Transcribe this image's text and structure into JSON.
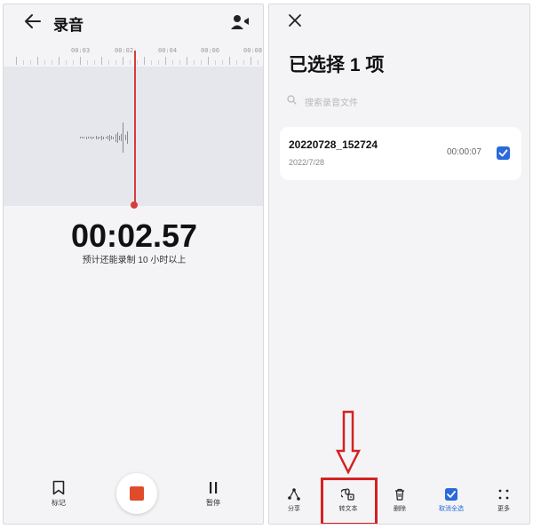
{
  "left_screen": {
    "title": "录音",
    "ruler_labels": [
      "00:03",
      "00:02",
      "00:04",
      "00:06",
      "00:08"
    ],
    "timer": "00:02.57",
    "remaining": "预计还能录制 10 小时以上",
    "toolbar": {
      "mark_label": "标记",
      "pause_label": "暂停"
    },
    "colors": {
      "record": "#e04b2b",
      "playhead": "#d93a3a"
    },
    "icons": [
      "back-arrow-icon",
      "speaker-icon",
      "bookmark-icon",
      "stop-icon",
      "pause-icon"
    ]
  },
  "right_screen": {
    "title": "已选择 1 项",
    "search_placeholder": "搜索录音文件",
    "file": {
      "name": "20220728_152724",
      "date": "2022/7/28",
      "duration": "00:00:07",
      "selected": true
    },
    "toolbar": {
      "share_label": "分享",
      "to_text_label": "转文本",
      "delete_label": "删除",
      "deselect_label": "取消全选",
      "more_label": "更多"
    },
    "colors": {
      "accent": "#2a6ad9",
      "annotation": "#d42222"
    },
    "icons": [
      "close-icon",
      "search-icon",
      "checkbox-icon",
      "share-icon",
      "to-text-icon",
      "delete-icon",
      "deselect-icon",
      "more-icon",
      "arrow-down-icon"
    ]
  }
}
